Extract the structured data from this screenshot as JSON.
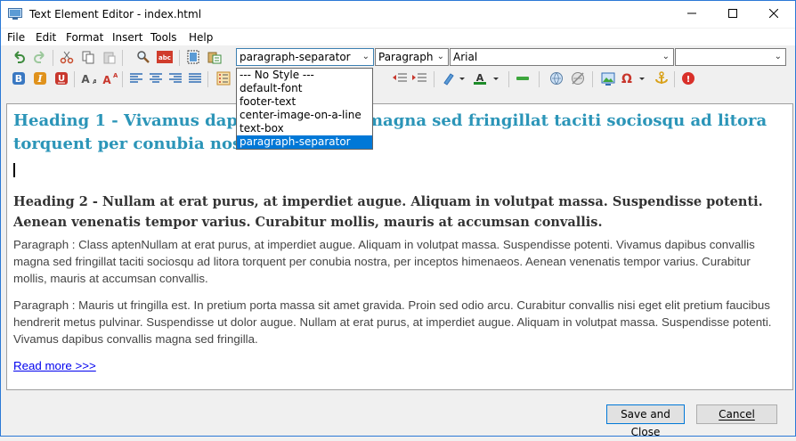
{
  "window": {
    "title": "Text Element Editor - index.html"
  },
  "menu": [
    "File",
    "Edit",
    "Format",
    "Insert",
    "Tools",
    "Help"
  ],
  "toolbar": {
    "style_combo": "paragraph-separator",
    "block_combo": "Paragraph",
    "font_combo": "Arial",
    "size_combo": ""
  },
  "style_dropdown": [
    "--- No Style ---",
    "default-font",
    "footer-text",
    "center-image-on-a-line",
    "text-box",
    "paragraph-separator"
  ],
  "content": {
    "h1": "Heading 1 - Vivamus dapibus convallis magna sed fringillat taciti sociosqu ad litora torquent per conubia nostra",
    "h2": "Heading 2 - Nullam at erat purus, at imperdiet augue. Aliquam in volutpat massa. Suspendisse potenti. Aenean venenatis tempor varius. Curabitur mollis, mauris at accumsan convallis.",
    "p1": "Paragraph : Class aptenNullam at erat purus, at imperdiet augue. Aliquam in volutpat massa. Suspendisse potenti. Vivamus dapibus convallis magna sed fringillat taciti sociosqu ad litora torquent per conubia nostra, per inceptos himenaeos. Aenean venenatis tempor varius. Curabitur mollis, mauris at accumsan convallis.",
    "p2": "Paragraph : Mauris ut fringilla est. In pretium porta massa sit amet gravida. Proin sed odio arcu. Curabitur convallis nisi eget elit pretium faucibus hendrerit metus pulvinar. Suspendisse ut dolor augue. Nullam at erat purus, at imperdiet augue. Aliquam in volutpat massa. Suspendisse potenti. Vivamus dapibus convallis magna sed fringilla.",
    "link": "Read more >>>"
  },
  "buttons": {
    "save": "Save and Close",
    "cancel": "Cancel"
  },
  "colors": {
    "heading1": "#2b95b8",
    "selection": "#0078d7",
    "link": "#0000ee"
  }
}
